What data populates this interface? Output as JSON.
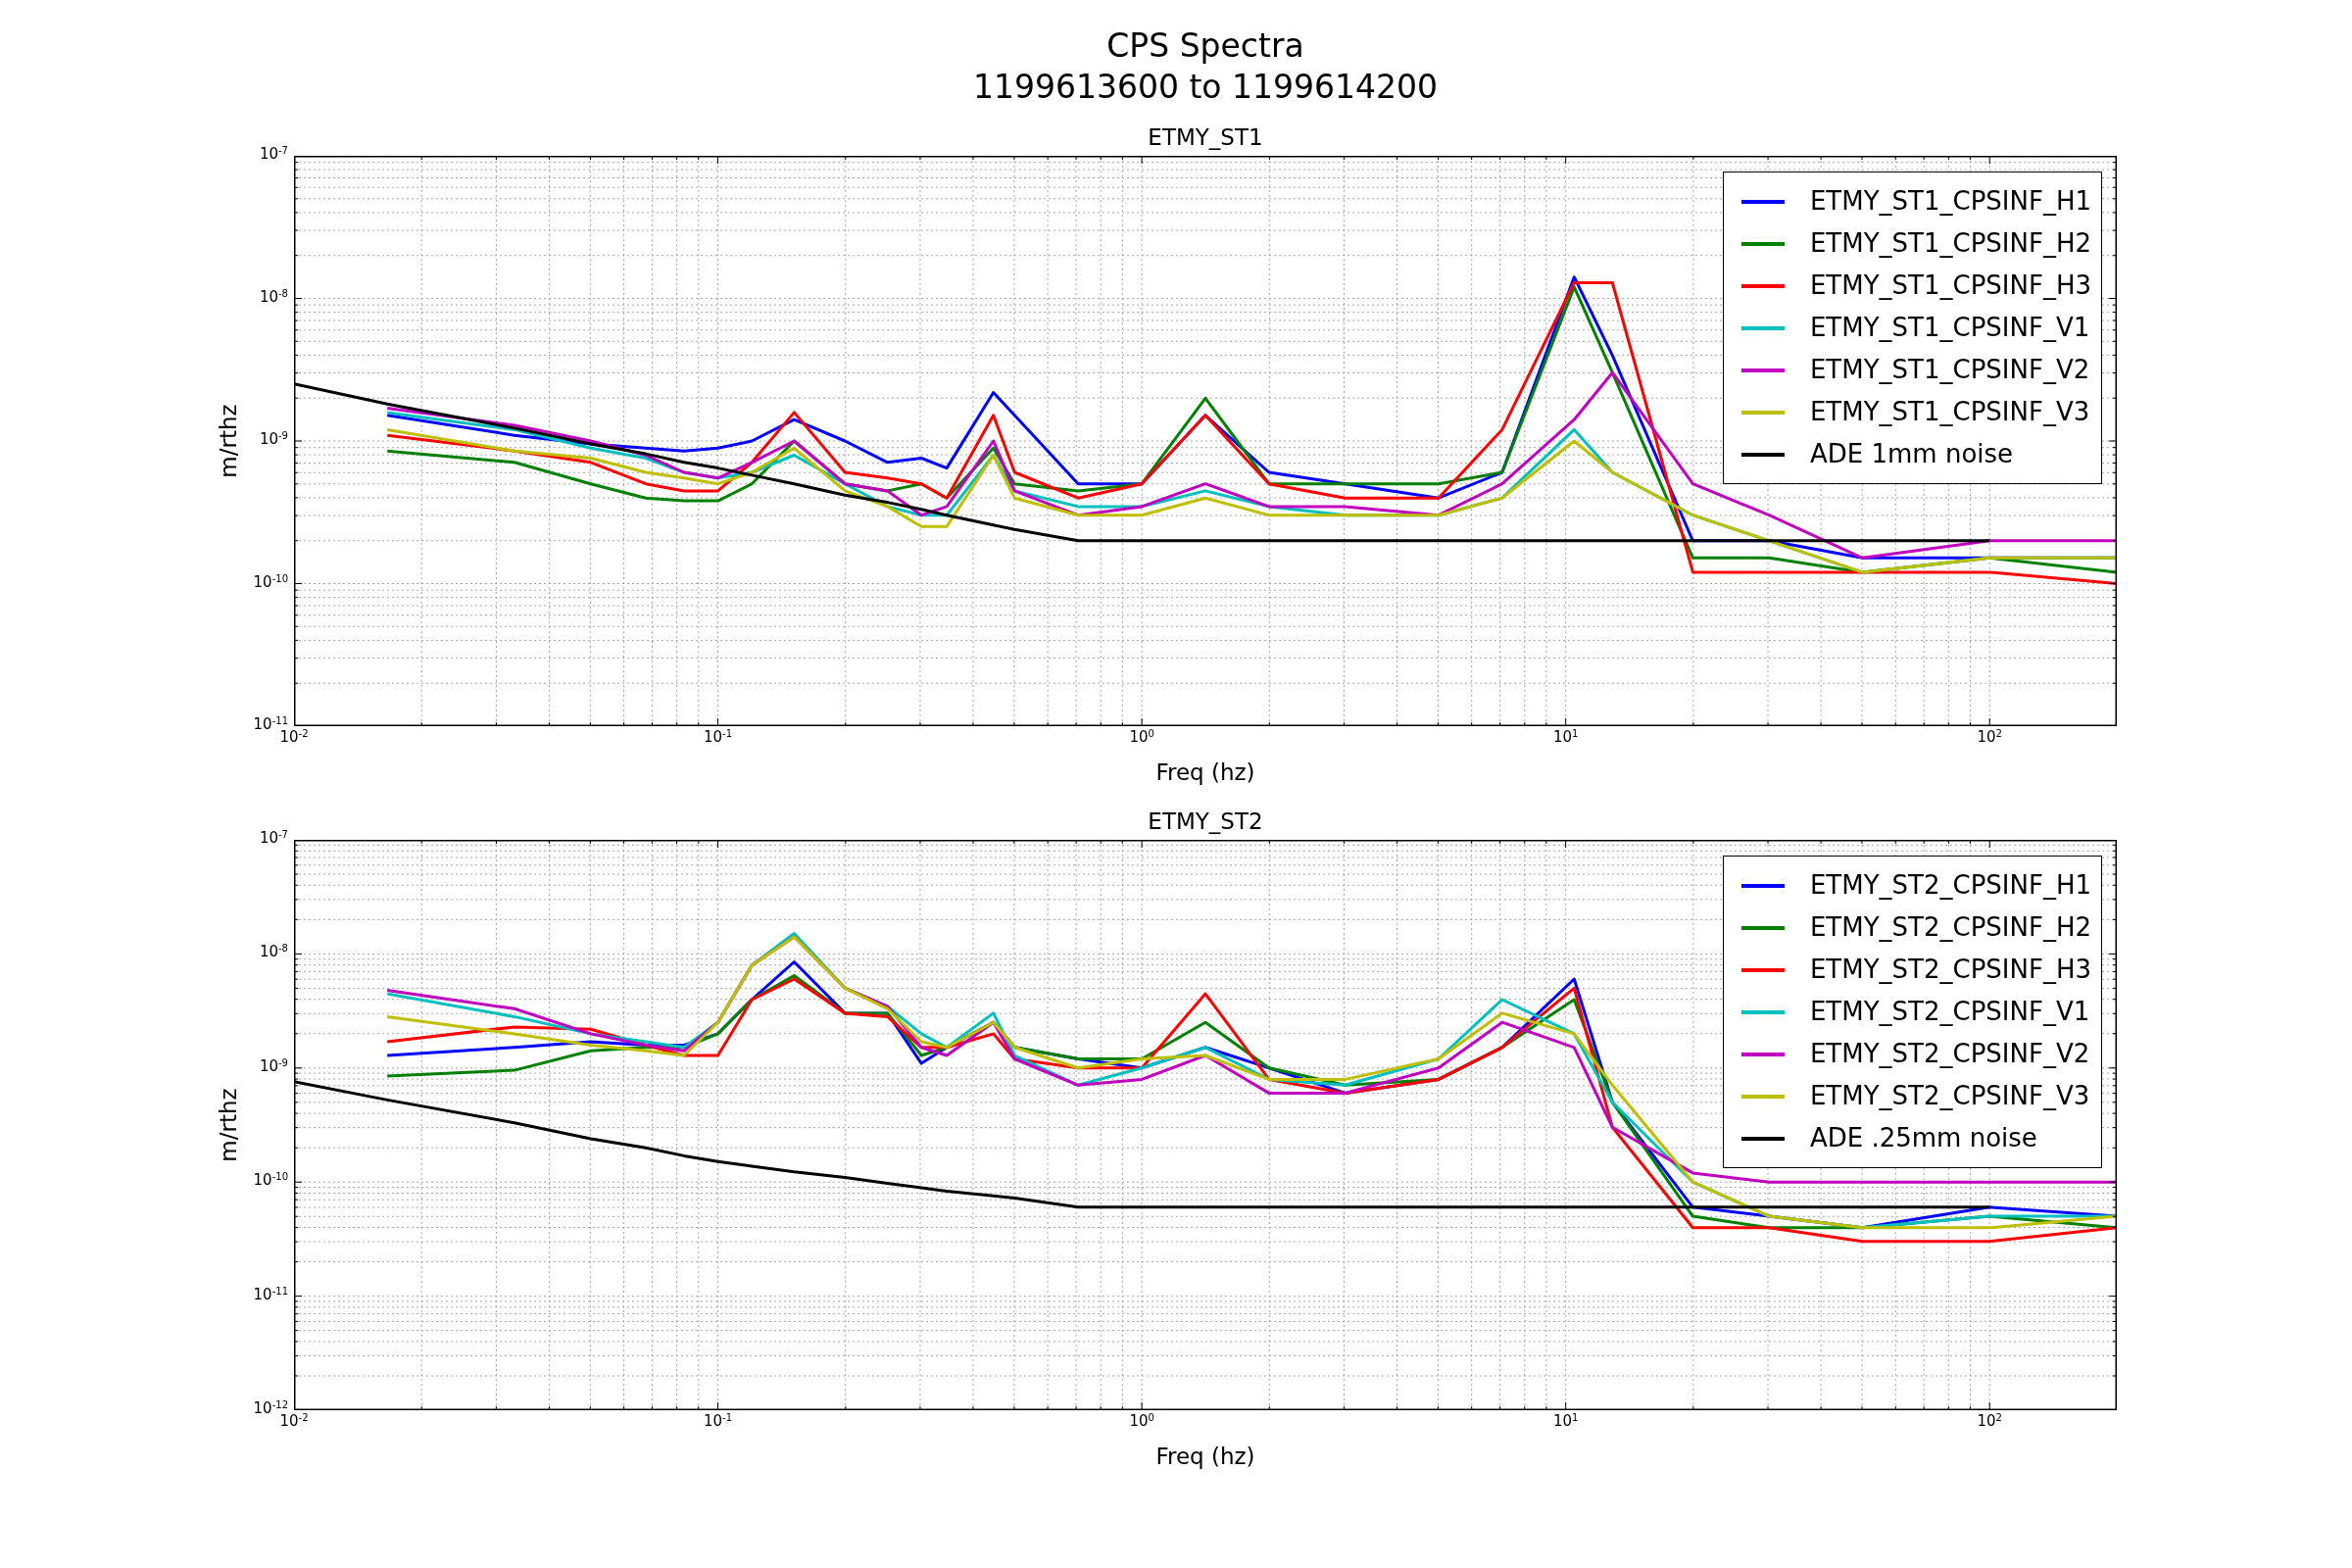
{
  "figure": {
    "title_lines": [
      "CPS Spectra",
      "1199613600 to 1199614200"
    ]
  },
  "panels": [
    {
      "title": "ETMY_ST1",
      "xlabel": "Freq (hz)",
      "ylabel": "m/rthz",
      "x_tick_labels": [
        "10$^{-2}$",
        "10$^{-1}$",
        "10$^{0}$",
        "10$^{1}$",
        "10$^{2}$"
      ],
      "y_tick_labels": [
        "10$^{-7}$",
        "10$^{-8}$",
        "10$^{-9}$",
        "10$^{-10}$",
        "10$^{-11}$"
      ],
      "legend": [
        {
          "name": "ETMY_ST1_CPSINF_H1",
          "color": "#0000ff"
        },
        {
          "name": "ETMY_ST1_CPSINF_H2",
          "color": "#008000"
        },
        {
          "name": "ETMY_ST1_CPSINF_H3",
          "color": "#ff0000"
        },
        {
          "name": "ETMY_ST1_CPSINF_V1",
          "color": "#00bfbf"
        },
        {
          "name": "ETMY_ST1_CPSINF_V2",
          "color": "#bf00bf"
        },
        {
          "name": "ETMY_ST1_CPSINF_V3",
          "color": "#bfbf00"
        },
        {
          "name": "ADE 1mm noise",
          "color": "#000000"
        }
      ]
    },
    {
      "title": "ETMY_ST2",
      "xlabel": "Freq (hz)",
      "ylabel": "m/rthz",
      "x_tick_labels": [
        "10$^{-2}$",
        "10$^{-1}$",
        "10$^{0}$",
        "10$^{1}$",
        "10$^{2}$"
      ],
      "y_tick_labels": [
        "10$^{-7}$",
        "10$^{-8}$",
        "10$^{-9}$",
        "10$^{-10}$",
        "10$^{-11}$",
        "10$^{-12}$"
      ],
      "legend": [
        {
          "name": "ETMY_ST2_CPSINF_H1",
          "color": "#0000ff"
        },
        {
          "name": "ETMY_ST2_CPSINF_H2",
          "color": "#008000"
        },
        {
          "name": "ETMY_ST2_CPSINF_H3",
          "color": "#ff0000"
        },
        {
          "name": "ETMY_ST2_CPSINF_V1",
          "color": "#00bfbf"
        },
        {
          "name": "ETMY_ST2_CPSINF_V2",
          "color": "#bf00bf"
        },
        {
          "name": "ETMY_ST2_CPSINF_V3",
          "color": "#bfbf00"
        },
        {
          "name": "ADE .25mm noise",
          "color": "#000000"
        }
      ]
    }
  ]
}
